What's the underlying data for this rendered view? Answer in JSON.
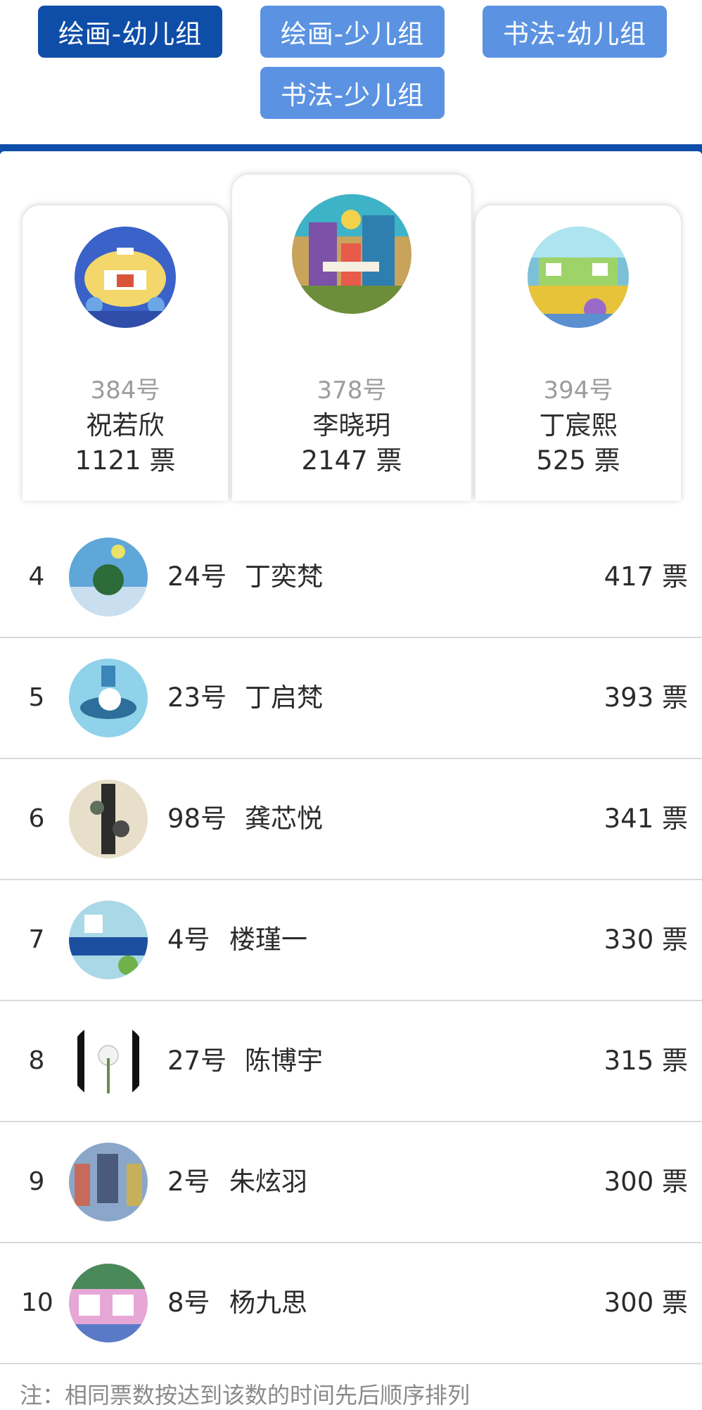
{
  "tabs": [
    {
      "label": "绘画-幼儿组",
      "active": true
    },
    {
      "label": "绘画-少儿组",
      "active": false
    },
    {
      "label": "书法-幼儿组",
      "active": false
    },
    {
      "label": "书法-少儿组",
      "active": false
    }
  ],
  "podium": {
    "first": {
      "rank": 1,
      "num": "378号",
      "name": "李晓玥",
      "votes": "2147 票"
    },
    "second": {
      "rank": 2,
      "num": "384号",
      "name": "祝若欣",
      "votes": "1121 票"
    },
    "third": {
      "rank": 3,
      "num": "394号",
      "name": "丁宸熙",
      "votes": "525 票"
    }
  },
  "list": [
    {
      "rank": "4",
      "num": "24号",
      "name": "丁奕梵",
      "votes": "417 票"
    },
    {
      "rank": "5",
      "num": "23号",
      "name": "丁启梵",
      "votes": "393 票"
    },
    {
      "rank": "6",
      "num": "98号",
      "name": "龚芯悦",
      "votes": "341 票"
    },
    {
      "rank": "7",
      "num": "4号",
      "name": "楼瑾一",
      "votes": "330 票"
    },
    {
      "rank": "8",
      "num": "27号",
      "name": "陈博宇",
      "votes": "315 票"
    },
    {
      "rank": "9",
      "num": "2号",
      "name": "朱炫羽",
      "votes": "300 票"
    },
    {
      "rank": "10",
      "num": "8号",
      "name": "杨九思",
      "votes": "300 票"
    }
  ],
  "note": "注：相同票数按达到该数的时间先后顺序排列",
  "colors": {
    "tab_active": "#0f4ea8",
    "tab_inactive": "#5b93e2"
  }
}
